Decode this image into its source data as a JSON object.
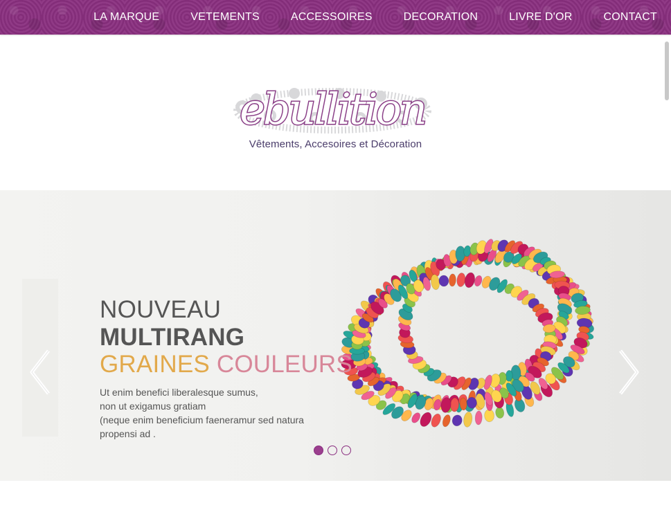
{
  "nav": {
    "items": [
      "LA MARQUE",
      "VETEMENTS",
      "ACCESSOIRES",
      "DECORATION",
      "LIVRE D'OR",
      "CONTACT"
    ]
  },
  "logo": {
    "wordmark": "ebullition",
    "tagline": "Vêtements, Accesoires et Décoration"
  },
  "slider": {
    "line1": "NOUVEAU",
    "line2": "MULTIRANG",
    "line3a": "GRAINES",
    "line3b": "COULEURS",
    "body": [
      "Ut enim benefici liberalesque sumus,",
      "non ut exigamus gratiam",
      "(neque enim beneficium faeneramur sed natura",
      "propensi ad ."
    ],
    "active_dot": 1,
    "dot_count": 3
  },
  "colors": {
    "brand_purple": "#8a2f80",
    "accent_gold": "#e2a94b",
    "accent_pink": "#d88799",
    "text_gray": "#555555"
  },
  "icons": {
    "prev": "chevron-left-icon",
    "next": "chevron-right-icon"
  }
}
